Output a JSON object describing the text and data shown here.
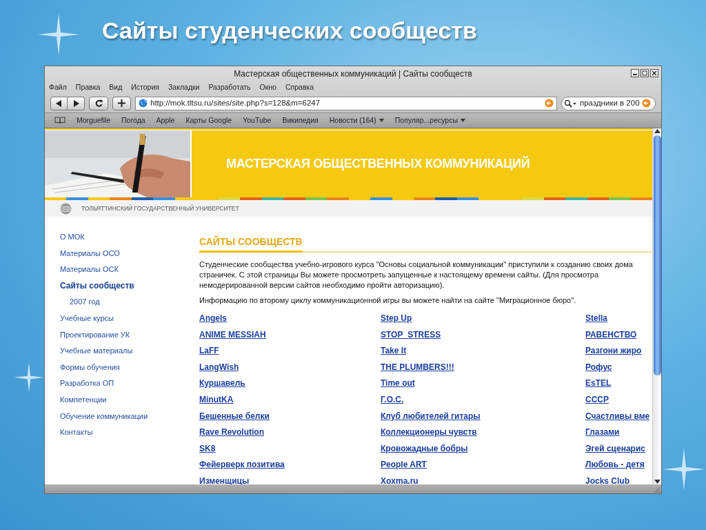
{
  "slide_title": "Сайты студенческих сообществ",
  "browser": {
    "title": "Мастерская общественных коммуникаций | Сайты сообществ",
    "menu": [
      "Файл",
      "Правка",
      "Вид",
      "История",
      "Закладки",
      "Разработать",
      "Окно",
      "Справка"
    ],
    "address": "http://mok.tltsu.ru/sites/site.php?s=128&m=6247",
    "search": "праздники в 200",
    "bookmarks": [
      {
        "label": "Morguefile",
        "menu": false
      },
      {
        "label": "Погода",
        "menu": false
      },
      {
        "label": "Apple",
        "menu": false
      },
      {
        "label": "Карты Google",
        "menu": false
      },
      {
        "label": "YouTube",
        "menu": false
      },
      {
        "label": "Википедия",
        "menu": false
      },
      {
        "label": "Новости (164)",
        "menu": true
      },
      {
        "label": "Популяр...ресурсы",
        "menu": true
      }
    ]
  },
  "page": {
    "banner_title": "МАСТЕРСКАЯ ОБЩЕСТВЕННЫХ КОММУНИКАЦИЙ",
    "university": "ТОЛЬЯТТИНСКИЙ ГОСУДАРСТВЕННЫЙ УНИВЕРСИТЕТ",
    "sidebar": [
      {
        "label": "О МОК",
        "selected": false
      },
      {
        "label": "Материалы ОСО",
        "selected": false
      },
      {
        "label": "Материалы ОСК",
        "selected": false
      },
      {
        "label": "Сайты сообществ",
        "selected": true,
        "children": [
          {
            "label": "2007 год",
            "selected": false
          }
        ]
      },
      {
        "label": "Учебные курсы",
        "selected": false
      },
      {
        "label": "Проектирование УК",
        "selected": false
      },
      {
        "label": "Учебные материалы",
        "selected": false
      },
      {
        "label": "Формы обучения",
        "selected": false
      },
      {
        "label": "Разработка ОП",
        "selected": false
      },
      {
        "label": "Компетенции",
        "selected": false
      },
      {
        "label": "Обучение коммуникации",
        "selected": false
      },
      {
        "label": "Контакты",
        "selected": false
      }
    ],
    "heading": "САЙТЫ СООБЩЕСТВ",
    "paragraphs": [
      "Студенческие сообщества учебно-игрового курса \"Основы социальной коммуникации\" приступили к созданию своих дома\nстраничек. С этой страницы Вы можете просмотреть запущенные к настоящему времени сайты. (Для просмотра\nнемодерированной версии сайтов необходимо пройти авторизацию).",
      "Информацию по второму циклу коммуникационной игры вы можете найти на сайте \"Миграционное бюро\"."
    ],
    "link_columns": [
      [
        "Angels",
        "ANIME MESSIAH",
        "LaFF",
        "LangWish",
        "Куршавель",
        "MinutKA",
        "Бешенные белки",
        "Rave Revolution",
        "SK8",
        "Фейерверк позитива",
        "Изменщицы"
      ],
      [
        "Step Up",
        "STOP_STRESS",
        "Take It",
        "THE PLUMBERS!!!",
        "Time out",
        "Г.О.С.",
        "Клуб любителей гитары",
        "Коллекционеры чувств",
        "Кровожадные бобры",
        "People ART",
        "Xoxma.ru"
      ],
      [
        "Stella",
        "РАВЕНСТВО",
        "Разгони жиро",
        "Рофус",
        "EsTEL",
        "СССР",
        "Счастливы вме",
        "Глазами",
        "Эгей сценарис",
        "Любовь - детя",
        "Jocks Club"
      ]
    ]
  }
}
